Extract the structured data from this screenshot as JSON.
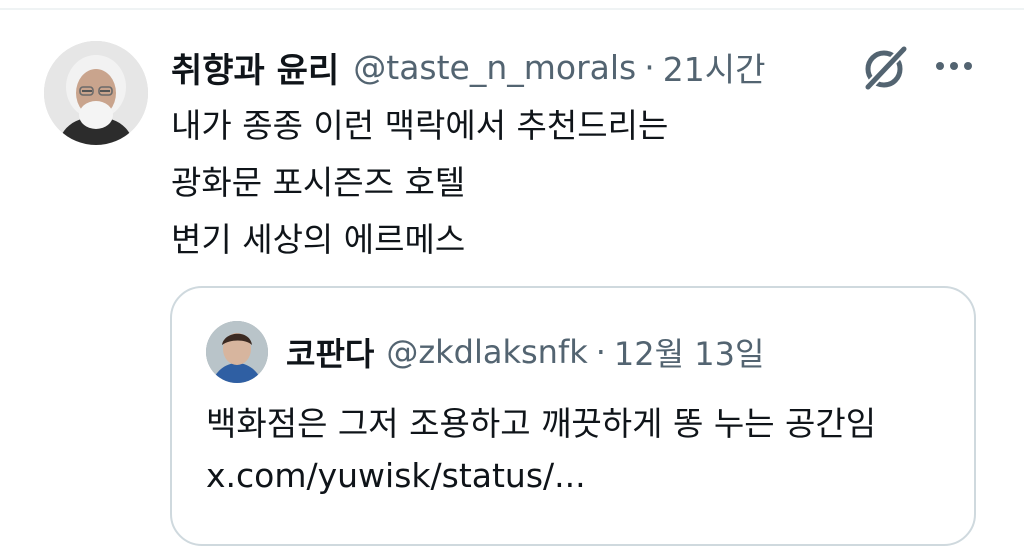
{
  "tweet": {
    "author": {
      "display_name": "취향과 윤리",
      "handle": "@taste_n_morals",
      "avatar": "avatar-elderly-man"
    },
    "separator": "·",
    "time": "21시간",
    "icons": {
      "grok": "grok-icon",
      "more": "more-icon"
    },
    "lines": [
      "내가 종종 이런 맥락에서 추천드리는",
      "광화문 포시즌즈 호텔",
      "변기 세상의 에르메스"
    ]
  },
  "quoted_tweet": {
    "author": {
      "display_name": "코판다",
      "handle": "@zkdlaksnfk",
      "avatar": "avatar-person"
    },
    "separator": "·",
    "time": "12월 13일",
    "lines": [
      "백화점은 그저 조용하고 깨끗하게 똥 누는 공간임",
      "x.com/yuwisk/status/..."
    ]
  },
  "colors": {
    "text_primary": "#0f1419",
    "text_secondary": "#536471",
    "border": "#cfd9de",
    "divider": "#eff3f4"
  }
}
